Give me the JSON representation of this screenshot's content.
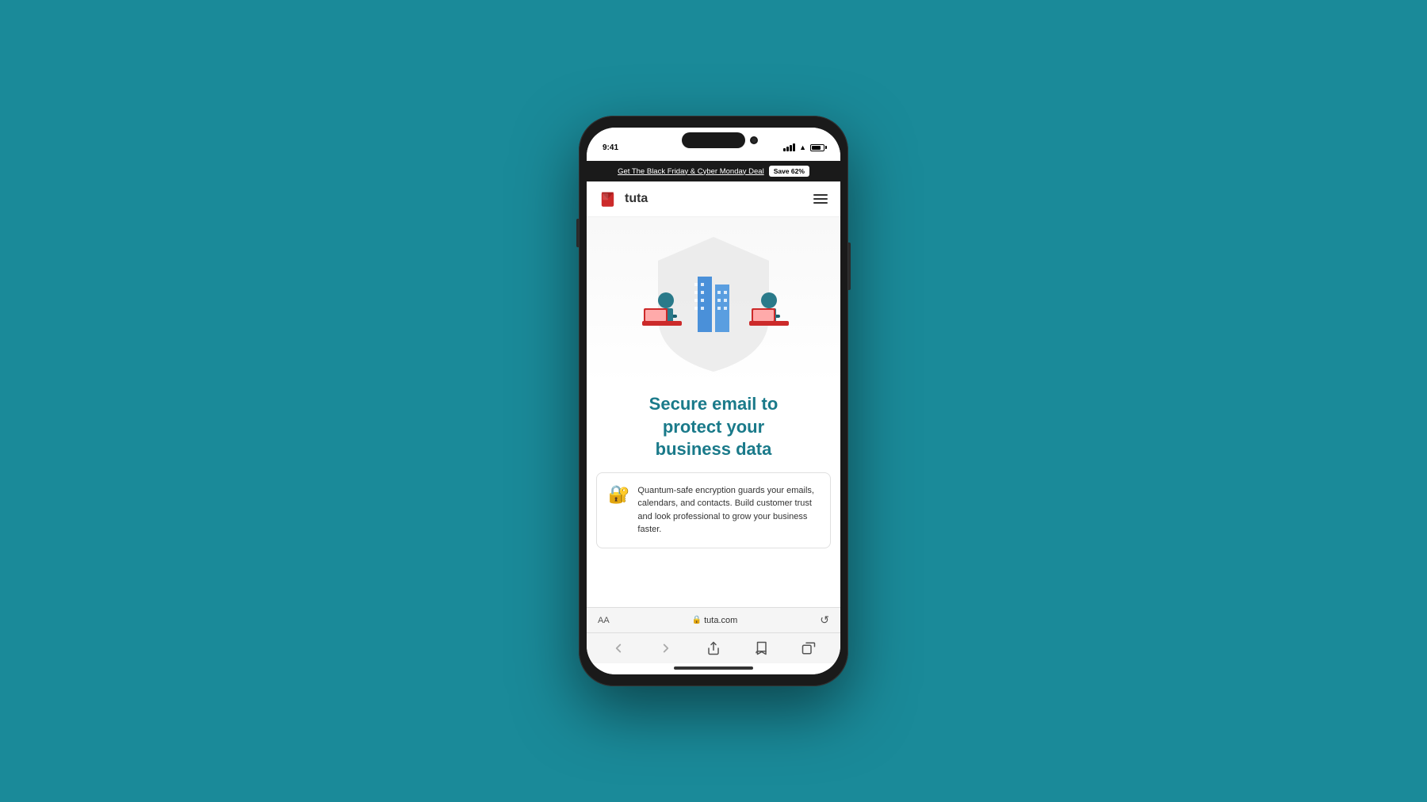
{
  "background_color": "#1a8a99",
  "phone": {
    "status_bar": {
      "time": "9:41",
      "signal": "●●●",
      "wifi": "WiFi",
      "battery": "100%"
    },
    "promo_banner": {
      "text": "Get The Black Friday & Cyber Monday Deal",
      "badge": "Save 62%"
    },
    "nav": {
      "logo_alt": "Tuta logo",
      "logo_text": "tuta",
      "menu_label": "Menu"
    },
    "hero": {
      "title_line1": "Secure email to",
      "title_line2": "protect your",
      "title_line3": "business data"
    },
    "feature_card": {
      "icon": "🔐",
      "text": "Quantum-safe encryption guards your emails, calendars, and contacts. Build customer trust and look professional to grow your business faster."
    },
    "address_bar": {
      "text_size_label": "AA",
      "url": "tuta.com",
      "lock_icon": "🔒",
      "reload_icon": "↺"
    },
    "bottom_nav": {
      "back": "‹",
      "forward": "›",
      "share": "⬆",
      "bookmarks": "📖",
      "tabs": "⧉"
    }
  }
}
